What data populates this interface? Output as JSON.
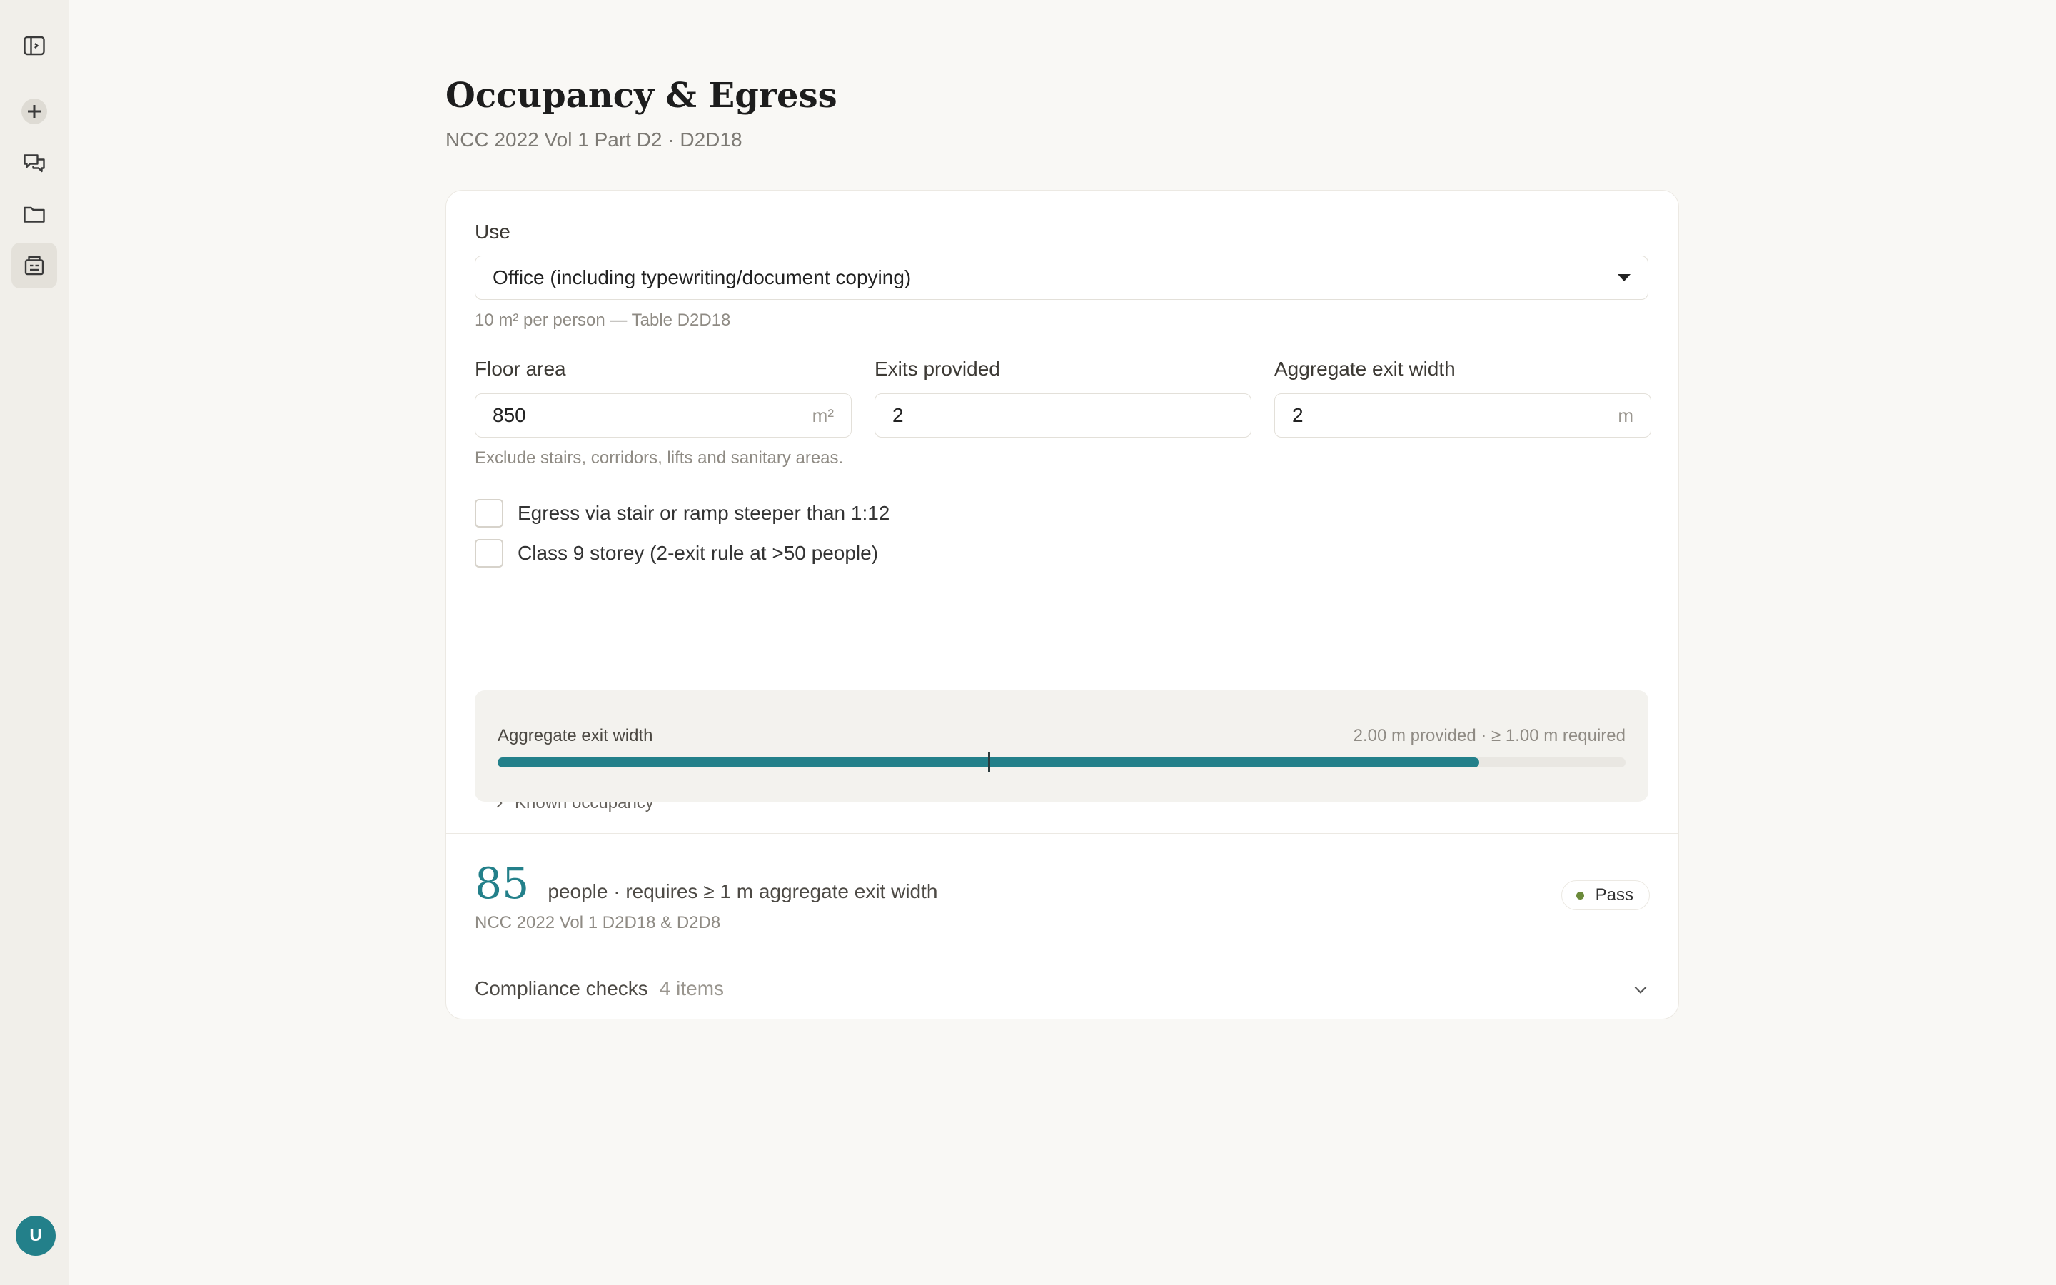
{
  "sidebar": {
    "items": [
      {
        "name": "toggle-sidebar",
        "icon": "sidebar-toggle-icon"
      },
      {
        "name": "new",
        "icon": "plus-icon"
      },
      {
        "name": "chats",
        "icon": "chat-bubbles-icon"
      },
      {
        "name": "projects",
        "icon": "folder-icon"
      },
      {
        "name": "tools",
        "icon": "calculator-icon",
        "active": true
      }
    ],
    "avatar_initial": "U"
  },
  "header": {
    "title": "Occupancy & Egress",
    "subtitle": "NCC 2022 Vol 1 Part D2 · D2D18"
  },
  "form": {
    "use_label": "Use",
    "use_value": "Office (including typewriting/document copying)",
    "use_hint": "10 m² per person — Table D2D18",
    "floor_area_label": "Floor area",
    "floor_area_value": "850",
    "floor_area_unit": "m²",
    "exits_label": "Exits provided",
    "exits_value": "2",
    "agg_width_label": "Aggregate exit width",
    "agg_width_value": "2",
    "agg_width_unit": "m",
    "area_hint": "Exclude stairs, corridors, lifts and sanitary areas.",
    "checkbox1_label": "Egress via stair or ramp steeper than 1:12",
    "checkbox1_checked": false,
    "checkbox2_label": "Class 9 storey (2-exit rule at >50 people)",
    "checkbox2_checked": false,
    "known_occupancy_label": "Known occupancy"
  },
  "meter": {
    "label": "Aggregate exit width",
    "readout": "2.00 m provided · ≥ 1.00 m required",
    "fill_fraction": 0.87,
    "required_marker_fraction": 0.435,
    "fill_color": "#23808a"
  },
  "result": {
    "count": "85",
    "description": "people · requires ≥ 1 m aggregate exit width",
    "reference": "NCC 2022 Vol 1 D2D18 & D2D8",
    "status": "Pass",
    "status_color": "#6b8a3a"
  },
  "compliance": {
    "title": "Compliance checks",
    "count": "4 items"
  },
  "colors": {
    "accent": "#23808a",
    "background": "#f9f8f5",
    "sidebar": "#f1efea"
  }
}
